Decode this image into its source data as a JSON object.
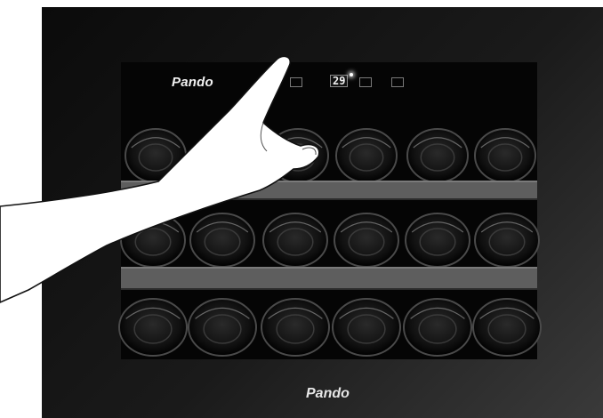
{
  "brand": {
    "top": "Pando",
    "bottom": "Pando"
  },
  "display": {
    "temperature": "29"
  },
  "colors": {
    "cabinet": "#111111",
    "shelf": "#5e5e5e",
    "hand": "#ffffff"
  }
}
